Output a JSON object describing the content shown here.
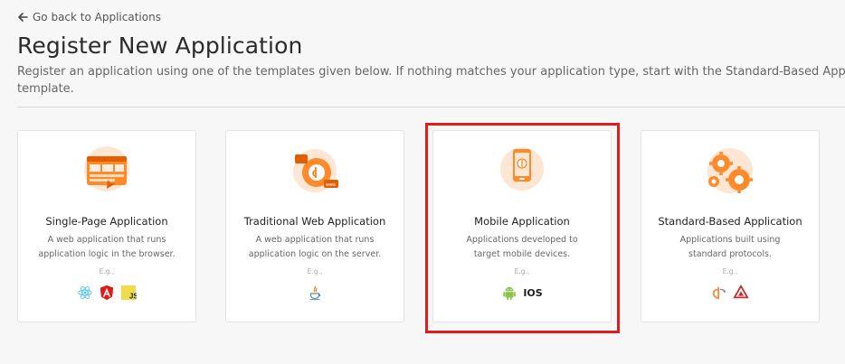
{
  "nav": {
    "back_label": "Go back to Applications"
  },
  "header": {
    "title": "Register New Application",
    "description_line1": "Register an application using one of the templates given below. If nothing matches your application type, start with the Standard-Based Applic",
    "description_line2": "template."
  },
  "cards": [
    {
      "title": "Single-Page Application",
      "description": "A web application that runs application logic in the browser.",
      "eg": "E.g.,",
      "techs": [
        "react-icon",
        "angular-icon",
        "javascript-icon"
      ]
    },
    {
      "title": "Traditional Web Application",
      "description": "A web application that runs application logic on the server.",
      "eg": "E.g.,",
      "techs": [
        "java-icon"
      ]
    },
    {
      "title": "Mobile Application",
      "description": "Applications developed to target mobile devices.",
      "eg": "E.g.,",
      "techs": [
        "android-icon",
        "ios-label"
      ],
      "ios_text": "IOS",
      "highlighted": true
    },
    {
      "title": "Standard-Based Application",
      "description": "Applications built using standard protocols.",
      "eg": "E.g.,",
      "techs": [
        "openid-icon",
        "saml-icon"
      ]
    }
  ],
  "colors": {
    "accent": "#ff7300",
    "highlight_border": "#e21b1b",
    "background": "#f7f7f7"
  },
  "js_label": "JS"
}
